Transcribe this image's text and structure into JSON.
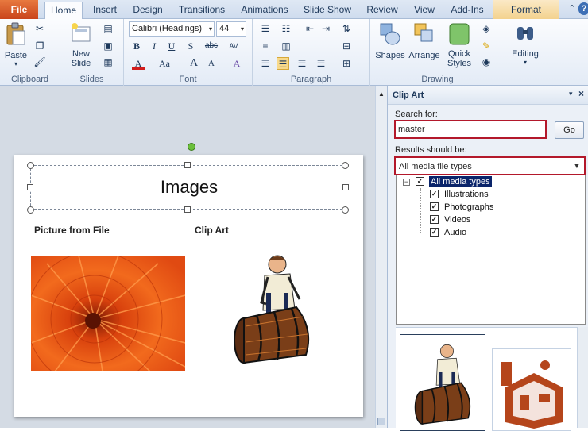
{
  "tabs": {
    "file": "File",
    "home": "Home",
    "insert": "Insert",
    "design": "Design",
    "transitions": "Transitions",
    "animations": "Animations",
    "slideshow": "Slide Show",
    "review": "Review",
    "view": "View",
    "addins": "Add-Ins",
    "format": "Format"
  },
  "ribbon": {
    "clipboard": {
      "paste": "Paste",
      "label": "Clipboard"
    },
    "slides": {
      "new_slide_line1": "New",
      "new_slide_line2": "Slide",
      "label": "Slides"
    },
    "font": {
      "font_name": "Calibri (Headings)",
      "font_size": "44",
      "label": "Font",
      "bold": "B",
      "italic": "I",
      "underline": "U",
      "shadow": "S",
      "strike": "abc",
      "spacing": "AV",
      "fontcolor": "A",
      "changecase": "Aa",
      "grow": "A",
      "shrink": "A",
      "clear": "A"
    },
    "paragraph": {
      "label": "Paragraph"
    },
    "drawing": {
      "shapes": "Shapes",
      "arrange": "Arrange",
      "quick_line1": "Quick",
      "quick_line2": "Styles",
      "label": "Drawing"
    },
    "editing": {
      "label": "Editing"
    }
  },
  "slide": {
    "title": "Images",
    "left_heading": "Picture from File",
    "right_heading": "Clip Art"
  },
  "clipart": {
    "title": "Clip Art",
    "search_label": "Search for:",
    "search_value": "master",
    "go": "Go",
    "results_label": "Results should be:",
    "results_value": "All media file types",
    "tree": {
      "all": "All media types",
      "illustrations": "Illustrations",
      "photographs": "Photographs",
      "videos": "Videos",
      "audio": "Audio"
    }
  }
}
